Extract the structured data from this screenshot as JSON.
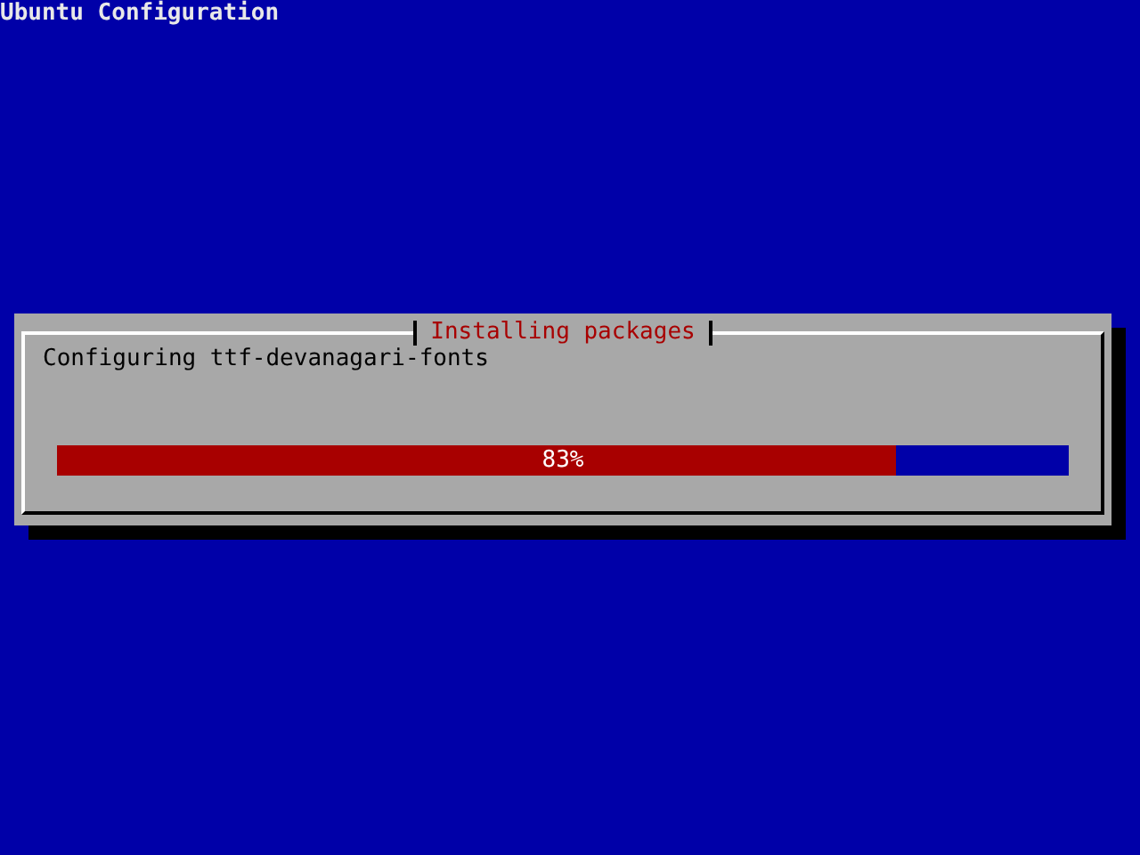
{
  "screen": {
    "title": "Ubuntu Configuration"
  },
  "dialog": {
    "title": "Installing packages",
    "message": "Configuring ttf-devanagari-fonts",
    "progress": {
      "level": 0.83,
      "reading": "83%"
    }
  }
}
